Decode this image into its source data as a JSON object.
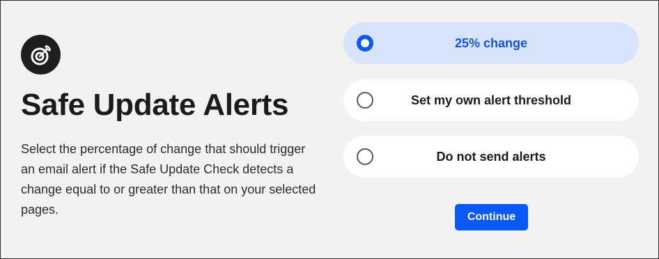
{
  "header": {
    "icon": "target-icon",
    "title": "Safe Update Alerts",
    "description": "Select the percentage of change that should trigger an email alert if the Safe Update Check detects a change equal to or greater than that on your selected pages."
  },
  "options": [
    {
      "label": "25% change",
      "selected": true
    },
    {
      "label": "Set my own alert threshold",
      "selected": false
    },
    {
      "label": "Do not send alerts",
      "selected": false
    }
  ],
  "actions": {
    "continue_label": "Continue"
  },
  "colors": {
    "accent": "#0a59f5",
    "selected_background": "#d7e4fc",
    "page_background": "#f2f2f2"
  }
}
